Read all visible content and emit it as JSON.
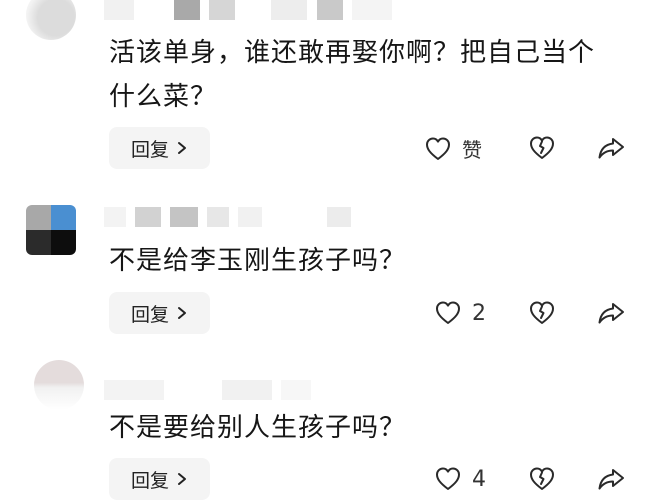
{
  "comments": [
    {
      "text_line1": "活该单身，谁还敢再娶你啊？把自己当个",
      "text_line2": "什么菜？",
      "reply_label": "回复",
      "like_label": "赞"
    },
    {
      "text_line1": "不是给李玉刚生孩子吗？",
      "reply_label": "回复",
      "like_count": "2"
    },
    {
      "text_line1": "不是要给别人生孩子吗？",
      "reply_label": "回复",
      "like_count": "4"
    }
  ],
  "icons": {
    "like": "heart-outline-icon",
    "dislike": "broken-heart-icon",
    "share": "share-arrow-icon",
    "reply_chevron": "chevron-right-icon"
  },
  "colors": {
    "text": "#161616",
    "reply_bg": "#f4f4f4",
    "icon_stroke": "#2a2a2a"
  }
}
